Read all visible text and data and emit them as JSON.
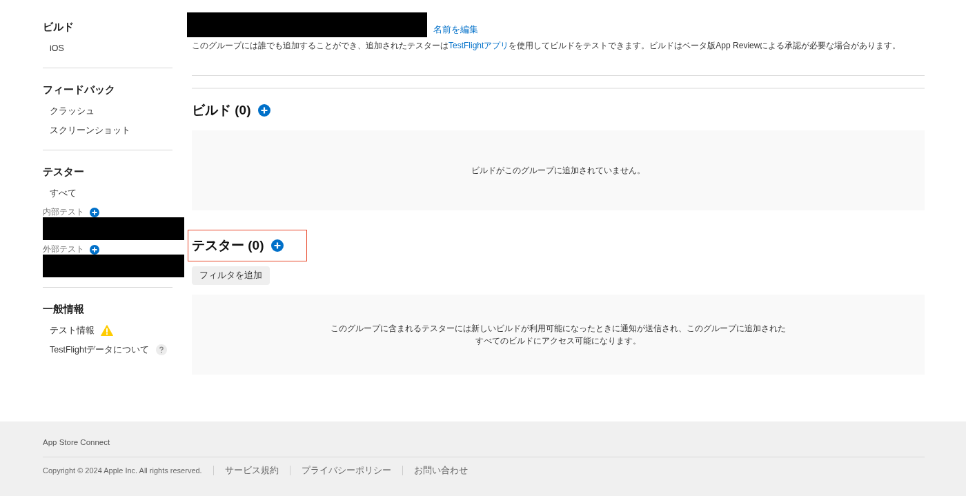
{
  "sidebar": {
    "sections": [
      {
        "title": "ビルド",
        "items": [
          {
            "label": "iOS",
            "kind": "plain"
          }
        ]
      },
      {
        "title": "フィードバック",
        "items": [
          {
            "label": "クラッシュ",
            "kind": "plain"
          },
          {
            "label": "スクリーンショット",
            "kind": "plain"
          }
        ]
      },
      {
        "title": "テスター",
        "items": [
          {
            "label": "すべて",
            "kind": "plain"
          }
        ],
        "groups": [
          {
            "label": "内部テスト"
          },
          {
            "label": "外部テスト"
          }
        ]
      },
      {
        "title": "一般情報",
        "items": [
          {
            "label": "テスト情報",
            "kind": "warning"
          },
          {
            "label": "TestFlightデータについて",
            "kind": "help"
          }
        ]
      }
    ]
  },
  "group": {
    "edit_link": "名前を編集",
    "description": {
      "before": "このグループには誰でも追加することができ、追加されたテスターは",
      "link": "TestFlightアプリ",
      "after": "を使用してビルドをテストできます。ビルドはベータ版App Reviewによる承認が必要な場合があります。"
    }
  },
  "builds": {
    "heading": "ビルド (0)",
    "empty": "ビルドがこのグループに追加されていません。"
  },
  "testers": {
    "heading": "テスター (0)",
    "highlighted": true,
    "filter_button": "フィルタを追加",
    "empty": "このグループに含まれるテスターには新しいビルドが利用可能になったときに通知が送信され、このグループに追加されたすべてのビルドにアクセス可能になります。"
  },
  "footer": {
    "brand": "App Store Connect",
    "copyright": "Copyright © 2024 Apple Inc. All rights reserved.",
    "links": [
      "サービス規約",
      "プライバシーポリシー",
      "お問い合わせ"
    ]
  }
}
